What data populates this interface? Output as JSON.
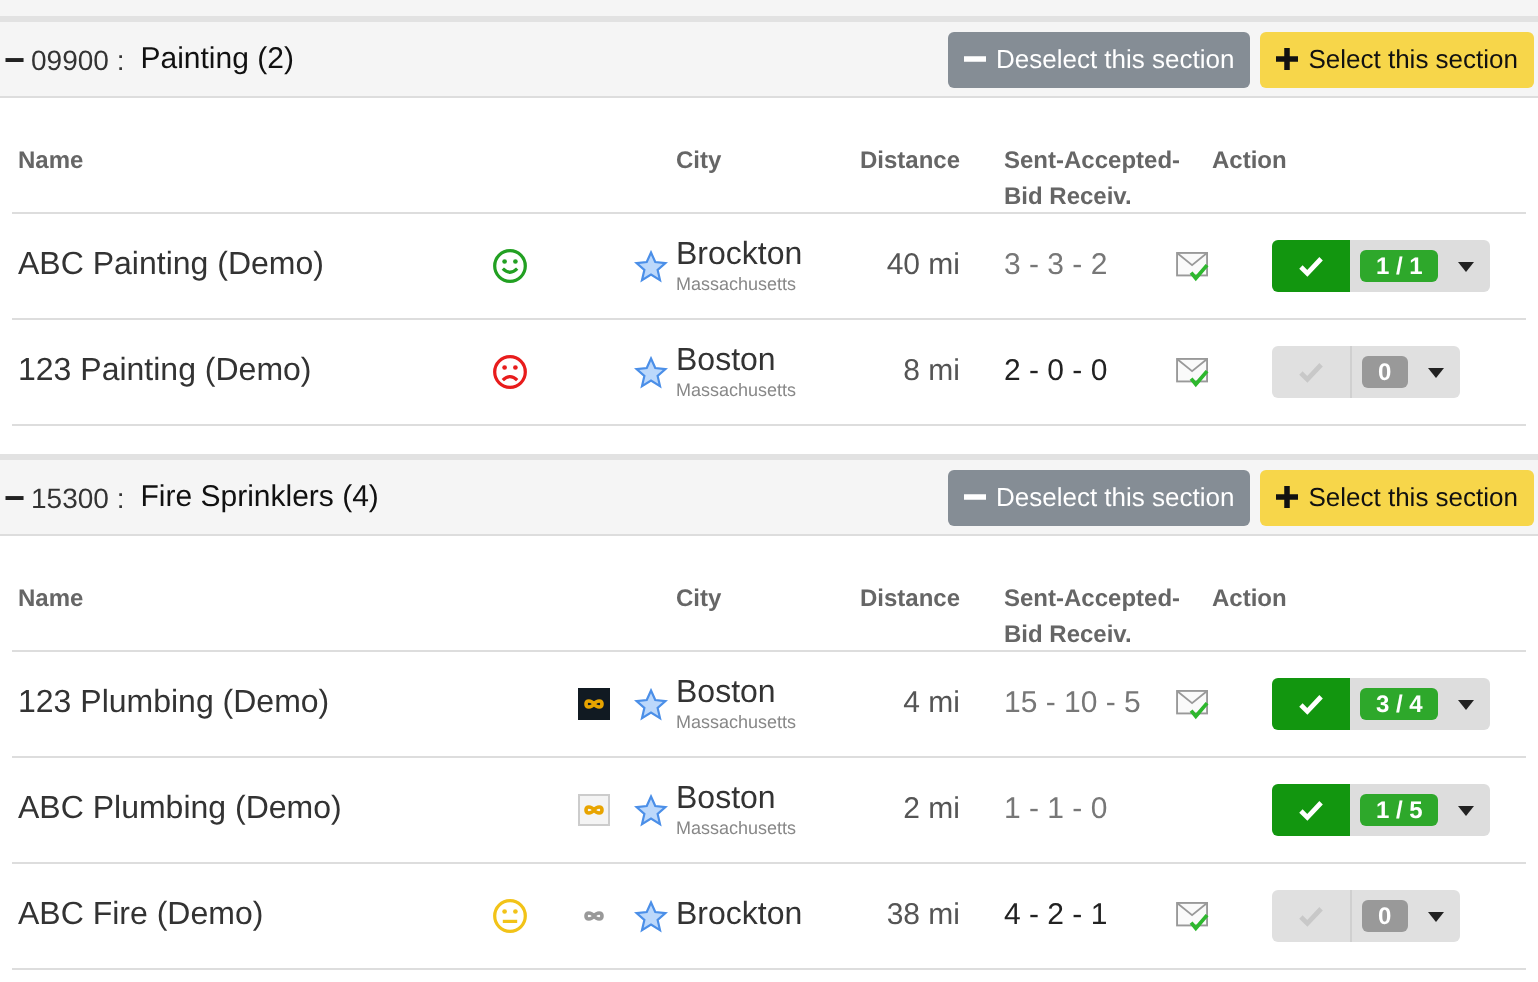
{
  "sections": [
    {
      "collapse_icon": "−",
      "code": "09900 :",
      "name": "Painting (2)",
      "deselect_button": "Deselect this section",
      "select_button": "Select this section",
      "columns": [
        "Name",
        "City",
        "Distance",
        "Sent-Accepted-Bid Receiv.",
        "Action"
      ],
      "rows": [
        {
          "name": "ABC Painting (Demo)",
          "smiley": {
            "kind": "happy"
          },
          "city": "Brockton",
          "state": "Massachusetts",
          "distance": "40 mi",
          "stats": "3 - 3 - 2",
          "stats_muted": true,
          "mail": true,
          "selected": true,
          "count": "1 / 1"
        },
        {
          "name": "123 Painting (Demo)",
          "smiley": {
            "kind": "sad"
          },
          "city": "Boston",
          "state": "Massachusetts",
          "distance": "8 mi",
          "stats": "2 - 0 - 0",
          "stats_muted": false,
          "mail": true,
          "selected": false,
          "count": "0"
        }
      ]
    },
    {
      "collapse_icon": "−",
      "code": "15300 :",
      "name": "Fire Sprinklers (4)",
      "deselect_button": "Deselect this section",
      "select_button": "Select this section",
      "columns": [
        "Name",
        "City",
        "Distance",
        "Sent-Accepted-Bid Receiv.",
        "Action"
      ],
      "rows": [
        {
          "name": "123 Plumbing (Demo)",
          "badge": {
            "kind": "dark"
          },
          "city": "Boston",
          "state": "Massachusetts",
          "distance": "4 mi",
          "stats": "15 - 10 - 5",
          "stats_muted": true,
          "mail": true,
          "selected": true,
          "count": "3 / 4"
        },
        {
          "name": "ABC Plumbing (Demo)",
          "badge": {
            "kind": "light"
          },
          "city": "Boston",
          "state": "Massachusetts",
          "distance": "2 mi",
          "stats": "1 - 1 - 0",
          "stats_muted": true,
          "mail": false,
          "selected": true,
          "count": "1 / 5"
        },
        {
          "name": "ABC Fire (Demo)",
          "smiley": {
            "kind": "neutral"
          },
          "badge": {
            "kind": "plain"
          },
          "city": "Brockton",
          "distance": "38 mi",
          "stats": "4 - 2 - 1",
          "stats_muted": false,
          "mail": true,
          "selected": false,
          "count": "0"
        }
      ]
    }
  ]
}
